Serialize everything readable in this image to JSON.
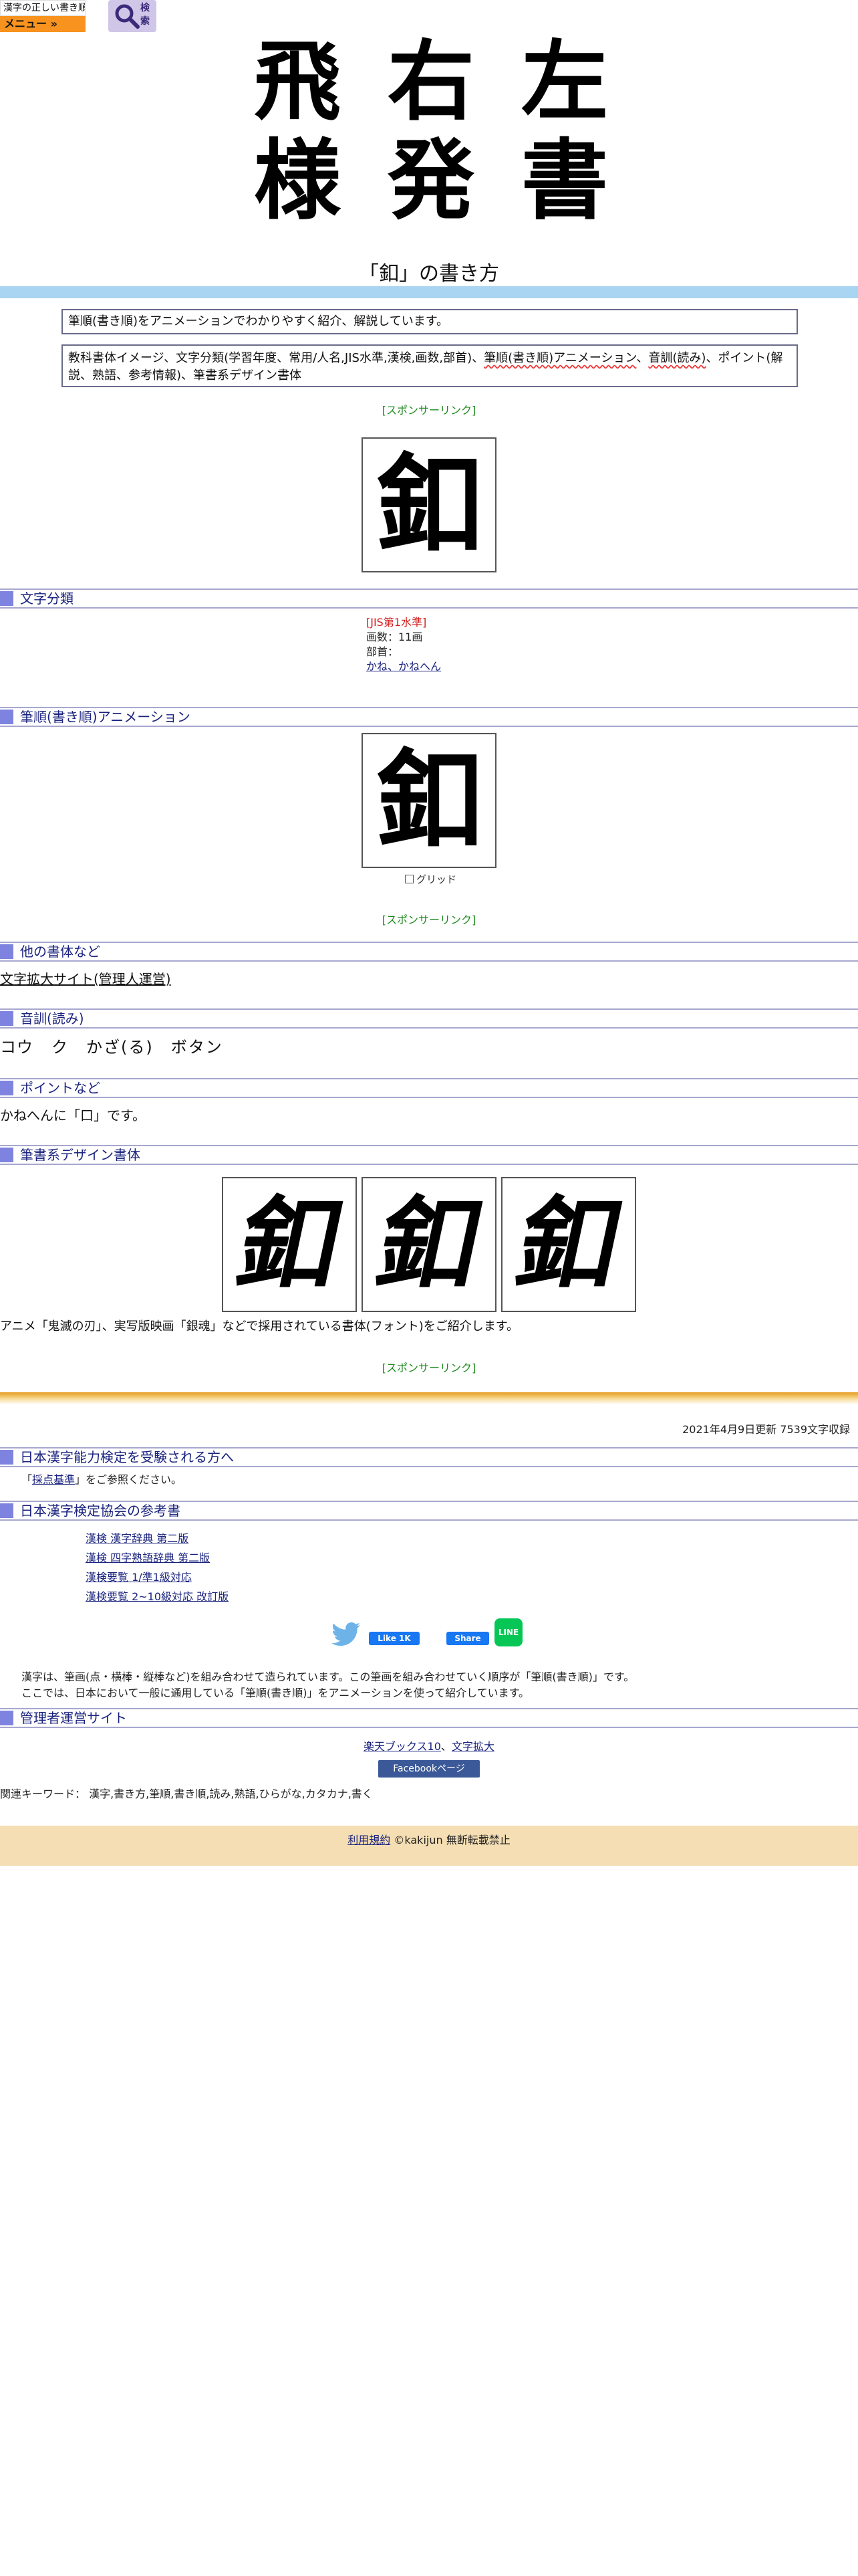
{
  "topbar": {
    "logo_text": "漢字の正しい書き順(筆順)",
    "menu_label": "メニュー »",
    "search_label": "検索"
  },
  "banner": {
    "row1": [
      "飛",
      "右",
      "左"
    ],
    "row2": [
      "様",
      "発",
      "書"
    ]
  },
  "page": {
    "title": "「釦」の書き方",
    "intro": "筆順(書き順)をアニメーションでわかりやすく紹介、解説しています。",
    "contents_pre": "教科書体イメージ、文字分類(学習年度、常用/人名,JIS水準,漢検,画数,部首)、",
    "contents_hl1": "筆順(書き順)アニメーション",
    "contents_mid": "、",
    "contents_hl2": "音訓(読み)",
    "contents_post": "、ポイント(解説、熟語、参考情報)、筆書系デザイン書体",
    "sponsor": "[スポンサーリンク]",
    "kanji": "釦"
  },
  "classification": {
    "heading": "文字分類",
    "jis": "[JIS第1水準]",
    "strokes": "画数：11画",
    "radical_label": "部首：",
    "radical_link": "かね、かねへん"
  },
  "animation": {
    "heading": "筆順(書き順)アニメーション",
    "grid_label": "グリッド"
  },
  "other_fonts": {
    "heading": "他の書体など",
    "link": "文字拡大サイト(管理人運営)"
  },
  "reading": {
    "heading": "音訓(読み)",
    "text": "コウ　ク　かざ(る)　ボタン"
  },
  "points": {
    "heading": "ポイントなど",
    "text": "かねへんに「口」です。"
  },
  "fude": {
    "heading": "筆書系デザイン書体",
    "caption": "アニメ「鬼滅の刃」、実写版映画「銀魂」などで採用されている書体(フォント)をご紹介します。"
  },
  "updated": "2021年4月9日更新 7539文字収録",
  "exam": {
    "heading": "日本漢字能力検定を受験される方へ",
    "text_pre": "「",
    "link": "採点基準",
    "text_post": "」をご参照ください。"
  },
  "references": {
    "heading": "日本漢字検定協会の参考書",
    "items": [
      "漢検 漢字辞典 第二版",
      "漢検 四字熟語辞典 第二版",
      "漢検要覧 1/準1級対応",
      "漢検要覧 2~10級対応 改訂版"
    ]
  },
  "share": {
    "like": "Like 1K",
    "share": "Share",
    "line": "LINE"
  },
  "description": {
    "line1": "漢字は、筆画(点・横棒・縦棒など)を組み合わせて造られています。この筆画を組み合わせていく順序が「筆順(書き順)」です。",
    "line2": "ここでは、日本において一般に通用している「筆順(書き順)」をアニメーションを使って紹介しています。"
  },
  "admin": {
    "heading": "管理者運営サイト",
    "link1": "楽天ブックス10",
    "sep": "、",
    "link2": "文字拡大",
    "fb_page": "Facebookページ"
  },
  "keywords": "関連キーワード： 漢字,書き方,筆順,書き順,読み,熟語,ひらがな,カタカナ,書く",
  "footer": {
    "terms": "利用規約",
    "copyright": "©kakijun 無断転載禁止"
  }
}
